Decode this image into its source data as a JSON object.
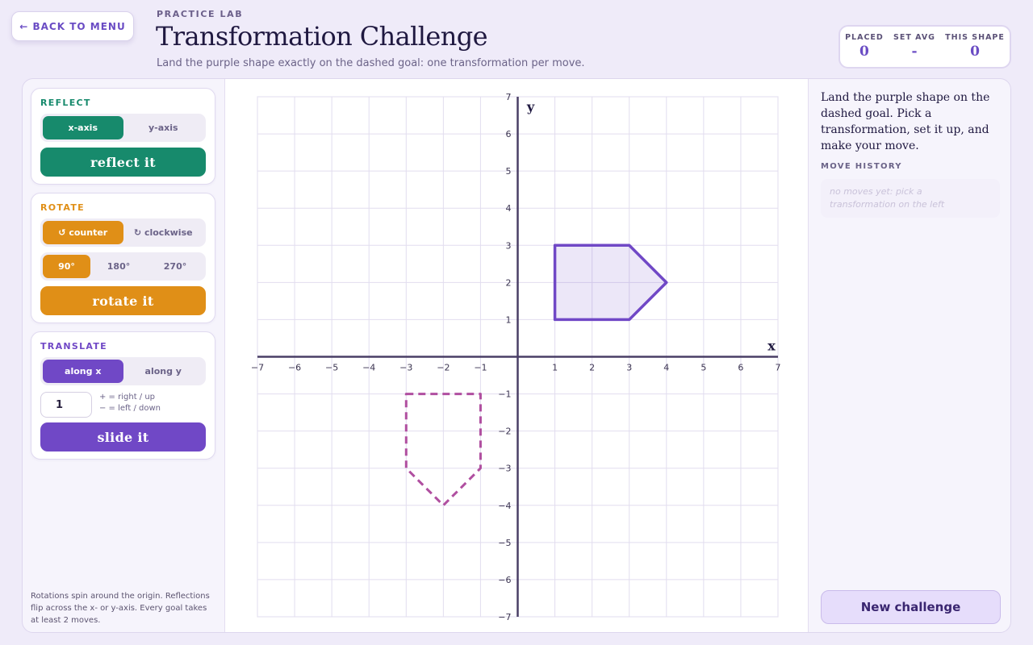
{
  "header": {
    "back_label": "← BACK TO MENU",
    "kicker": "PRACTICE LAB",
    "title": "Transformation Challenge",
    "subtitle": "Land the purple shape exactly on the dashed goal: one transformation per move."
  },
  "scores": [
    {
      "label": "PLACED",
      "value": "0"
    },
    {
      "label": "SET AVG",
      "value": "-"
    },
    {
      "label": "THIS SHAPE",
      "value": "0"
    }
  ],
  "reflect": {
    "title": "REFLECT",
    "options": [
      "x-axis",
      "y-axis"
    ],
    "selected": "x-axis",
    "button": "reflect it",
    "color": "#178a6c"
  },
  "rotate": {
    "title": "ROTATE",
    "directions": [
      "↺ counter",
      "↻ clockwise"
    ],
    "selected_direction": "↺ counter",
    "angles": [
      "90°",
      "180°",
      "270°"
    ],
    "selected_angle": "90°",
    "button": "rotate it",
    "color": "#e08f17"
  },
  "translate": {
    "title": "TRANSLATE",
    "options": [
      "along x",
      "along y"
    ],
    "selected": "along x",
    "amount": "1",
    "hint_positive": "+ = right / up",
    "hint_negative": "− = left / down",
    "button": "slide it",
    "color": "#7048c6"
  },
  "footnote": "Rotations spin around the origin. Reflections flip across the x- or y-axis. Every goal takes at least 2 moves.",
  "graph": {
    "x_label": "x",
    "y_label": "y",
    "x_range": [
      -7,
      7
    ],
    "y_range": [
      -7,
      7
    ],
    "shape_points": [
      [
        1,
        1
      ],
      [
        1,
        3
      ],
      [
        3,
        3
      ],
      [
        4,
        2
      ],
      [
        3,
        1
      ]
    ],
    "goal_points": [
      [
        -3,
        -1
      ],
      [
        -1,
        -1
      ],
      [
        -1,
        -3
      ],
      [
        -2,
        -4
      ],
      [
        -3,
        -3
      ]
    ],
    "shape_color": "#7048c6",
    "goal_color": "#b04fa0"
  },
  "sidebar": {
    "instructions": "Land the purple shape on the dashed goal. Pick a transformation, set it up, and make your move.",
    "history_label": "MOVE HISTORY",
    "history_empty": "no moves yet: pick a transformation on the left",
    "new_button": "New challenge"
  }
}
